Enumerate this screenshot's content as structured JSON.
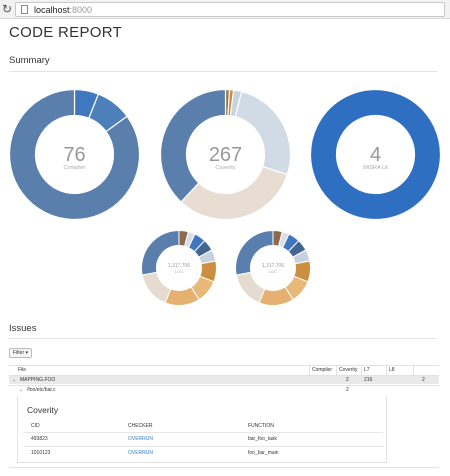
{
  "browser": {
    "url_host": "localhost",
    "url_port": ":8000"
  },
  "page": {
    "title": "CODE REPORT"
  },
  "summary": {
    "title": "Summary",
    "donuts": [
      {
        "value": "76",
        "label": "Compiler",
        "segments": [
          {
            "fraction": 0.06,
            "color": "#3f78be"
          },
          {
            "fraction": 0.09,
            "color": "#4d80b8"
          },
          {
            "fraction": 0.85,
            "color": "#5a7fad"
          }
        ]
      },
      {
        "value": "267",
        "label": "Coverity",
        "segments": [
          {
            "fraction": 0.01,
            "color": "#9a7355"
          },
          {
            "fraction": 0.01,
            "color": "#c98a3a"
          },
          {
            "fraction": 0.02,
            "color": "#c8d3e0"
          },
          {
            "fraction": 0.26,
            "color": "#d1dbe6"
          },
          {
            "fraction": 0.32,
            "color": "#e7ddd2"
          },
          {
            "fraction": 0.38,
            "color": "#5a7fad"
          }
        ]
      },
      {
        "value": "4",
        "label": "MISRA Lit",
        "segments": [
          {
            "fraction": 1.0,
            "color": "#2f6fc2"
          }
        ]
      },
      {
        "value": "1,317,706",
        "label": "LOC",
        "segments": [
          {
            "fraction": 0.04,
            "color": "#8b6a4e"
          },
          {
            "fraction": 0.03,
            "color": "#d9dde6"
          },
          {
            "fraction": 0.05,
            "color": "#3f78be"
          },
          {
            "fraction": 0.05,
            "color": "#44658f"
          },
          {
            "fraction": 0.05,
            "color": "#c7d2df"
          },
          {
            "fraction": 0.09,
            "color": "#cc8f3f"
          },
          {
            "fraction": 0.1,
            "color": "#e7b878"
          },
          {
            "fraction": 0.15,
            "color": "#e6b070"
          },
          {
            "fraction": 0.16,
            "color": "#e5dbd0"
          },
          {
            "fraction": 0.28,
            "color": "#5a7fad"
          }
        ]
      },
      {
        "value": "1,317,706",
        "label": "LOC",
        "segments": [
          {
            "fraction": 0.04,
            "color": "#8b6a4e"
          },
          {
            "fraction": 0.03,
            "color": "#d9dde6"
          },
          {
            "fraction": 0.05,
            "color": "#3f78be"
          },
          {
            "fraction": 0.05,
            "color": "#44658f"
          },
          {
            "fraction": 0.05,
            "color": "#c7d2df"
          },
          {
            "fraction": 0.09,
            "color": "#cc8f3f"
          },
          {
            "fraction": 0.1,
            "color": "#e7b878"
          },
          {
            "fraction": 0.15,
            "color": "#e6b070"
          },
          {
            "fraction": 0.16,
            "color": "#e5dbd0"
          },
          {
            "fraction": 0.28,
            "color": "#5a7fad"
          }
        ]
      }
    ]
  },
  "issues": {
    "title": "Issues",
    "filter_label": "Filter ▾",
    "columns": {
      "file": "File",
      "compiler": "Compiler",
      "coverity": "Coverity",
      "l7": "L7",
      "l8": "L8"
    },
    "group_row": {
      "name": "MAPPING.FOO",
      "coverity": "2",
      "l7": "216",
      "extra": "2"
    },
    "sub_row": {
      "name": "/foo/etc/bar.c",
      "coverity": "2"
    },
    "detail": {
      "title": "Coverity",
      "headers": {
        "cid": "CID",
        "checker": "CHECKER",
        "function": "FUNCTION"
      },
      "rows": [
        {
          "cid": "493823",
          "checker": "OVERRUN",
          "function": "bar_foo_task"
        },
        {
          "cid": "1010123",
          "checker": "OVERRUN",
          "function": "foo_bar_main"
        }
      ]
    }
  }
}
